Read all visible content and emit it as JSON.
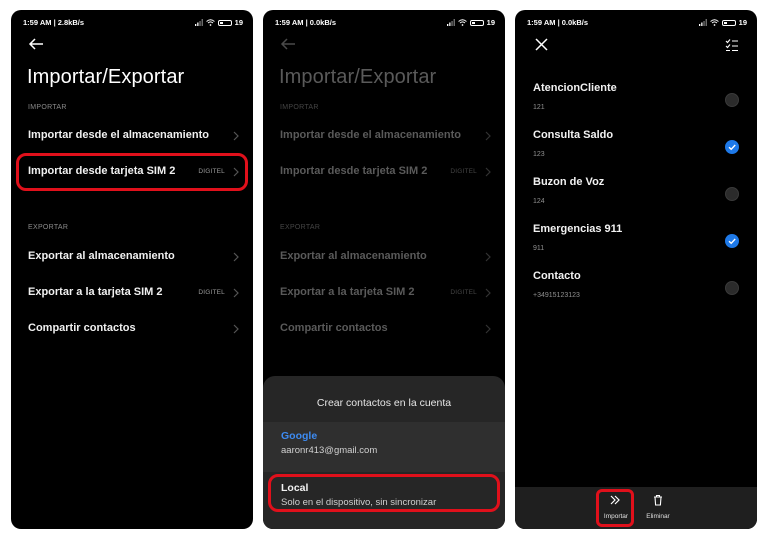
{
  "phone1": {
    "status": {
      "time": "1:59 AM | 2.8kB/s",
      "battery": "19"
    },
    "title": "Importar/Exportar",
    "import_section": "IMPORTAR",
    "import_items": [
      {
        "label": "Importar desde el almacenamiento",
        "badge": ""
      },
      {
        "label": "Importar desde tarjeta SIM 2",
        "badge": "DIGITEL"
      }
    ],
    "export_section": "EXPORTAR",
    "export_items": [
      {
        "label": "Exportar al almacenamiento",
        "badge": ""
      },
      {
        "label": "Exportar a la tarjeta SIM 2",
        "badge": "DIGITEL"
      },
      {
        "label": "Compartir contactos",
        "badge": ""
      }
    ]
  },
  "phone2": {
    "status": {
      "time": "1:59 AM | 0.0kB/s",
      "battery": "19"
    },
    "title": "Importar/Exportar",
    "import_section": "IMPORTAR",
    "import_items": [
      {
        "label": "Importar desde el almacenamiento",
        "badge": ""
      },
      {
        "label": "Importar desde tarjeta SIM 2",
        "badge": "DIGITEL"
      }
    ],
    "export_section": "EXPORTAR",
    "export_items": [
      {
        "label": "Exportar al almacenamiento",
        "badge": ""
      },
      {
        "label": "Exportar a la tarjeta SIM 2",
        "badge": "DIGITEL"
      },
      {
        "label": "Compartir contactos",
        "badge": ""
      }
    ],
    "sheet": {
      "title": "Crear contactos en la cuenta",
      "accounts": [
        {
          "name": "Google",
          "detail": "aaronr413@gmail.com"
        },
        {
          "name": "Local",
          "detail": "Solo en el dispositivo, sin sincronizar"
        }
      ]
    }
  },
  "phone3": {
    "status": {
      "time": "1:59 AM | 0.0kB/s",
      "battery": "19"
    },
    "contacts": [
      {
        "name": "AtencionCliente",
        "number": "121",
        "selected": false
      },
      {
        "name": "Consulta Saldo",
        "number": "123",
        "selected": true
      },
      {
        "name": "Buzon de Voz",
        "number": "124",
        "selected": false
      },
      {
        "name": "Emergencias 911",
        "number": "911",
        "selected": true
      },
      {
        "name": "Contacto",
        "number": "+34915123123",
        "selected": false
      }
    ],
    "actions": {
      "import": "Importar",
      "delete": "Eliminar"
    }
  },
  "colors": {
    "accent_blue": "#1e79e8",
    "google_blue": "#3d8bf2",
    "highlight_red": "#e0101b"
  },
  "icons": [
    "back-arrow-icon",
    "chevron-right-icon",
    "close-icon",
    "select-all-icon",
    "import-icon",
    "trash-icon",
    "signal-icon",
    "wifi-icon",
    "battery-icon"
  ]
}
